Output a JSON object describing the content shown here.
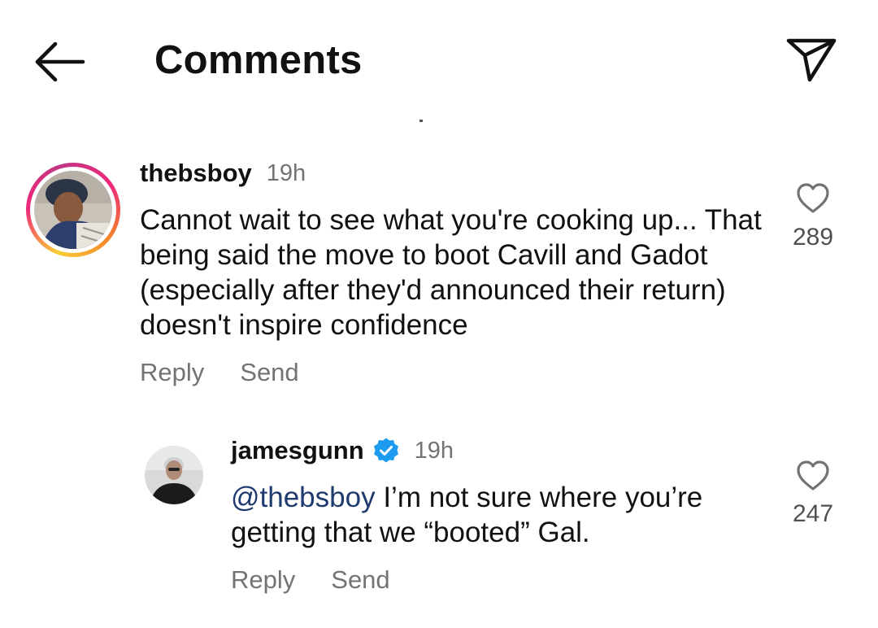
{
  "header": {
    "title": "Comments",
    "back_icon": "arrow-left-icon",
    "share_icon": "paper-plane-icon"
  },
  "comments": [
    {
      "username": "thebsboy",
      "time": "19h",
      "text": "Cannot wait to see what you're cooking up... That being said the move to boot Cavill and Gadot (especially after they'd announced their return) doesn't inspire confidence",
      "likes": "289",
      "reply_label": "Reply",
      "send_label": "Send",
      "has_story_ring": true,
      "verified": false
    },
    {
      "username": "jamesgunn",
      "time": "19h",
      "mention": "@thebsboy",
      "text": " I’m not sure where you’re getting that we “booted” Gal.",
      "likes": "247",
      "reply_label": "Reply",
      "send_label": "Send",
      "has_story_ring": false,
      "verified": true
    }
  ],
  "colors": {
    "text": "#111111",
    "secondary": "#737373",
    "mention": "#1e3a6e",
    "verified_badge": "#1d9bf0"
  }
}
